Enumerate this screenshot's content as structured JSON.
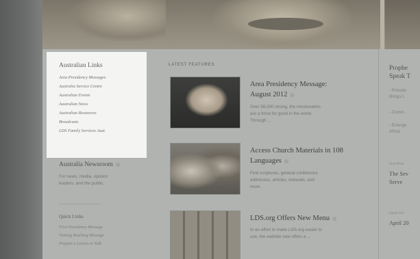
{
  "links_panel": {
    "title": "Australian Links",
    "items": [
      "Area Presidency Messages",
      "Australia Service Centre",
      "Australian Events",
      "Australian News",
      "Australian Resources",
      "Broadcasts",
      "LDS Family Services Aust."
    ]
  },
  "newsroom": {
    "title": "Australia Newsroom",
    "icon": "circle-arrow-icon",
    "description_lines": [
      "For news, media, opinion",
      "leaders, and the public."
    ]
  },
  "quick_links": {
    "title": "Quick Links",
    "items": [
      "First Presidency Message",
      "Visiting Teaching Message",
      "Prepare a Lesson or Talk"
    ]
  },
  "latest_features": {
    "label": "LATEST FEATURES",
    "items": [
      {
        "title_lines": [
          "Area Presidency Message:",
          "August 2012"
        ],
        "description_lines": [
          "Over 56,000 strong, the missionaries",
          "are a force for good in the world.",
          "Through ..."
        ],
        "image": "portrait-photo"
      },
      {
        "title_lines": [
          "Access Church Materials in 108",
          "Languages"
        ],
        "description_lines": [
          "Find scriptures, general conference",
          "addresses, articles, manuals, and",
          "more."
        ],
        "image": "family-reading-photo"
      },
      {
        "title_lines": [
          "LDS.org Offers New Menu"
        ],
        "description_lines": [
          "In an effort to make LDS.org easier to",
          "use, the website now offers a ..."
        ],
        "image": "menu-screenshot"
      }
    ]
  },
  "right_column": {
    "title_lines": [
      "Prophe",
      "Speak T"
    ],
    "bullets": [
      [
        "- Preside",
        "Brings L"
      ],
      [
        "- Comm"
      ],
      [
        "- Emerge",
        "Africa"
      ]
    ],
    "item1_tag": "First Presi",
    "item1_lines": [
      "The Sev",
      "Serve"
    ],
    "item2_tag": "Latest Unc",
    "item2_lines": [
      "April 20"
    ]
  },
  "colors": {
    "panel_bg": "#f4f4f3",
    "page_bg": "#b0b3b0",
    "text_dark": "#3f4241"
  }
}
